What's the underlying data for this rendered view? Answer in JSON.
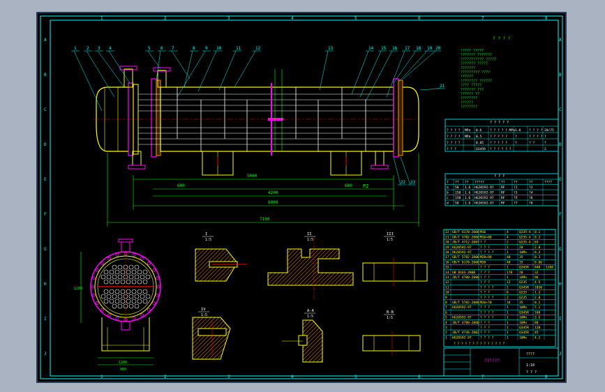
{
  "drawing": {
    "zone_labels_top": [
      "1",
      "2",
      "3",
      "4",
      "5",
      "6",
      "7",
      "8"
    ],
    "zone_labels_side": [
      "A",
      "B",
      "C",
      "D",
      "E",
      "F",
      "G",
      "H",
      "I",
      "J"
    ],
    "tech_title": "? ? ? ?",
    "tech_lines": [
      "????? ?????",
      "??????? ???????",
      "??????????? ?????",
      "??????? ?????",
      "???????",
      "????????? ????",
      "??????",
      "???????? ??????",
      "???? ?????",
      "??????? ???",
      "?????? ??",
      "????????",
      "??????",
      "????????"
    ],
    "spec_table": {
      "title": "? ? ? ? ?",
      "rows": [
        [
          "? ? ? ?",
          "MPa",
          "0.6",
          "? ? ? ? ? MPa",
          "1.0",
          "? ? ? ?",
          "20/75"
        ],
        [
          "? ? ? ?",
          "MPa",
          "0.5",
          "? ? ? ? ?",
          "?",
          "? ? ? ?",
          "?"
        ],
        [
          "? ? ? ?",
          "",
          "0.85",
          "? ? ? ? ?",
          "?",
          "? ?",
          "?"
        ],
        [
          "? ? ?",
          "",
          "Q345R",
          "? ? ? ? ? ?",
          "",
          "",
          "2"
        ]
      ]
    },
    "nozzle_table": {
      "title": "? ? ?",
      "headers": [
        "?",
        "??",
        "??",
        "?????",
        "??",
        "??",
        "??",
        "????"
      ],
      "rows": [
        [
          "a",
          "50",
          "1.6",
          "HG20592-97",
          "RF",
          "?1",
          "?2",
          ""
        ],
        [
          "b",
          "150",
          "1.6",
          "HG20592-97",
          "RF",
          "?3",
          "?4",
          ""
        ],
        [
          "c",
          "150",
          "1.6",
          "HG20592-97",
          "RF",
          "?5",
          "?6",
          ""
        ],
        [
          "d",
          "50",
          "1.6",
          "HG20592-97",
          "RF",
          "?7",
          "?8",
          ""
        ]
      ]
    },
    "parts_list": {
      "rows": [
        [
          "22",
          "GB/T 6170-2000",
          "M16",
          "4",
          "Q235-A",
          "0.1",
          ""
        ],
        [
          "21",
          "GB/T 5782-2000",
          "M16×80",
          "4",
          "Q235-A",
          "0.2",
          ""
        ],
        [
          "20",
          "JB/T 4712-2007",
          "? ?",
          "2",
          "Q235-A",
          "65",
          ""
        ],
        [
          "19",
          "HG20592-97",
          "? ? ?",
          "1",
          "20",
          "2.8",
          ""
        ],
        [
          "18",
          "HG20592-97",
          "? ? ? ?",
          "1",
          "16Mn",
          "8.2",
          ""
        ],
        [
          "17",
          "GB/T 5782-2000",
          "M20×90",
          "40",
          "35",
          "0.3",
          ""
        ],
        [
          "16",
          "GB/T 6170-2000",
          "M20",
          "40",
          "35",
          "0.06",
          ""
        ],
        [
          "15",
          "",
          "? ? ?",
          "1",
          "Q345R",
          "840",
          "1200"
        ],
        [
          "14",
          "GB 8163-2008",
          "? ? ?",
          "178",
          "20",
          "32",
          ""
        ],
        [
          "13",
          "JB/T 4700-2000",
          "? ? ?",
          "1",
          "16Mn",
          "96",
          ""
        ],
        [
          "12",
          "",
          "? ? ?",
          "12",
          "Q235",
          "4.5",
          ""
        ],
        [
          "11",
          "",
          "? ? ? ?",
          "1",
          "Q345R",
          "1030",
          ""
        ],
        [
          "10",
          "",
          "? ? ?",
          "8",
          "Q235",
          "1.2",
          ""
        ],
        [
          "9",
          "",
          "? ? ? ?",
          "2",
          "Q235",
          "2.8",
          ""
        ],
        [
          "8",
          "GB/T 5782-2000",
          "M16×70",
          "16",
          "35",
          "0.1",
          ""
        ],
        [
          "7",
          "HG20592-97",
          "? ? ?",
          "1",
          "16Mn",
          "5.1",
          ""
        ],
        [
          "6",
          "",
          "? ? ? ?",
          "1",
          "Q345R",
          "160",
          ""
        ],
        [
          "5",
          "HG20592-97",
          "? ? ? ?",
          "1",
          "16Mn",
          "3.5",
          ""
        ],
        [
          "4",
          "JB/T 4700-2000",
          "? ? ?",
          "1",
          "16Mn",
          "88",
          ""
        ],
        [
          "3",
          "",
          "? ? ?",
          "1",
          "Q345R",
          "120",
          ""
        ],
        [
          "2",
          "JB/T 4746-2002",
          "? ? ?",
          "1",
          "Q345R",
          "45",
          ""
        ],
        [
          "1",
          "HG20592-97",
          "? ? ? ?",
          "1",
          "16Mn",
          "4.2",
          ""
        ]
      ],
      "footer": "? ? ?  ? ?  ? ? ?  ? ?  ? ?  ? ?"
    },
    "title_block": {
      "drawing_title": "??????",
      "sub_title": "????",
      "scale_label": "1:10",
      "sheet_label": "? ? ?"
    },
    "callouts": [
      "1",
      "2",
      "3",
      "4",
      "5",
      "6",
      "7",
      "8",
      "9",
      "10",
      "11",
      "12",
      "13",
      "14",
      "15",
      "16",
      "17",
      "18",
      "19",
      "20",
      "21",
      "22",
      "23"
    ],
    "dimensions": {
      "overall_length": "7100",
      "support_span": "4200",
      "tube_length": "6000",
      "left_offset": "600",
      "right_offset": "600",
      "section_length": "5000",
      "vertical": "1200",
      "end_view_width": "1200",
      "end_view_base": "900"
    },
    "section_views": [
      {
        "label": "I",
        "scale": "1:5"
      },
      {
        "label": "II",
        "scale": "1:5"
      },
      {
        "label": "III",
        "scale": "1:5"
      },
      {
        "label": "IV",
        "scale": "1:5"
      },
      {
        "label": "A-A",
        "scale": "1:5"
      },
      {
        "label": "B-B",
        "scale": "1:5"
      }
    ],
    "colors": {
      "frame": "#00ffff",
      "outline": "#ffff00",
      "flange": "#ff00ff",
      "tube": "#ffffff",
      "dim": "#00ff00",
      "hatch": "#ff8800",
      "centerline": "#ff0000"
    }
  }
}
